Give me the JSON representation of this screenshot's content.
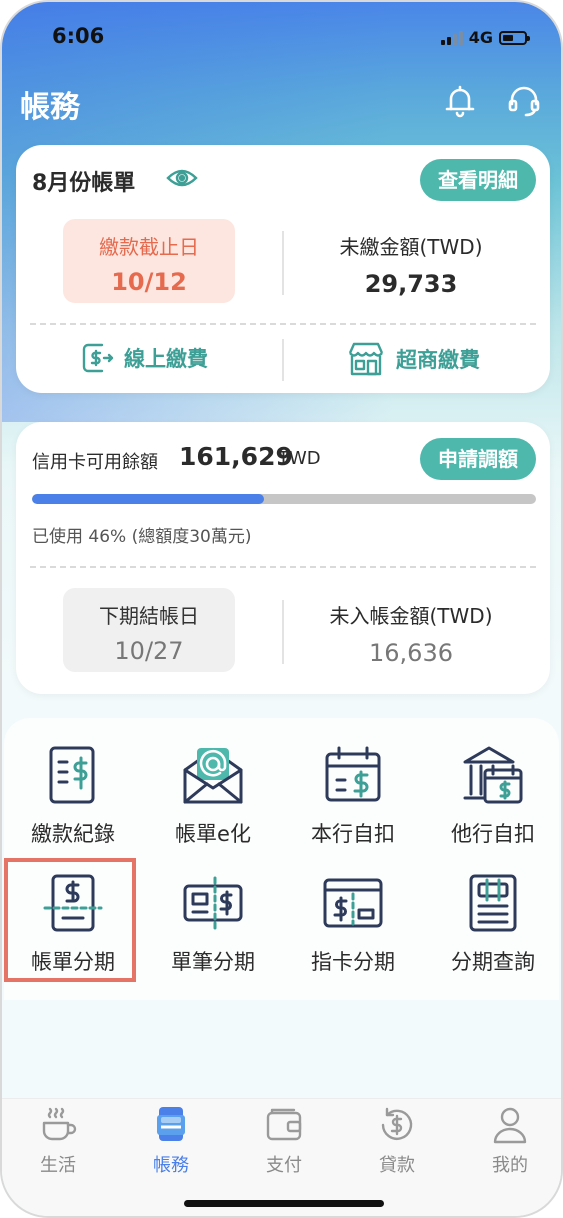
{
  "status": {
    "time": "6:06",
    "network": "4G"
  },
  "header": {
    "title": "帳務"
  },
  "bill": {
    "title": "8月份帳單",
    "detail_button": "查看明細",
    "due_label": "繳款截止日",
    "due_value": "10/12",
    "unpaid_label": "未繳金額(TWD)",
    "unpaid_value": "29,733",
    "online_pay": "線上繳費",
    "store_pay": "超商繳費"
  },
  "credit": {
    "available_label": "信用卡可用餘額",
    "available_amount": "161,629",
    "unit": "TWD",
    "raise_button": "申請調額",
    "used_percent": 46,
    "used_text": "已使用 46% (總額度30萬元)",
    "close_label": "下期結帳日",
    "close_value": "10/27",
    "unbilled_label": "未入帳金額(TWD)",
    "unbilled_value": "16,636"
  },
  "menu": [
    {
      "label": "繳款紀錄",
      "icon": "receipt-dollar-icon"
    },
    {
      "label": "帳單e化",
      "icon": "email-envelope-icon"
    },
    {
      "label": "本行自扣",
      "icon": "calendar-dollar-icon"
    },
    {
      "label": "他行自扣",
      "icon": "bank-calendar-icon"
    },
    {
      "label": "帳單分期",
      "icon": "bill-installment-icon"
    },
    {
      "label": "單筆分期",
      "icon": "ticket-dollar-icon"
    },
    {
      "label": "指卡分期",
      "icon": "card-dollar-icon"
    },
    {
      "label": "分期查詢",
      "icon": "query-document-icon"
    }
  ],
  "tabs": [
    {
      "label": "生活",
      "icon": "coffee-cup-icon"
    },
    {
      "label": "帳務",
      "icon": "cards-stack-icon",
      "active": true
    },
    {
      "label": "支付",
      "icon": "wallet-icon"
    },
    {
      "label": "貸款",
      "icon": "refresh-dollar-icon"
    },
    {
      "label": "我的",
      "icon": "person-icon"
    }
  ],
  "colors": {
    "accent": "#4fb8ad",
    "alert": "#e56a4e",
    "primary": "#4a80e8",
    "highlight": "#e57366"
  }
}
